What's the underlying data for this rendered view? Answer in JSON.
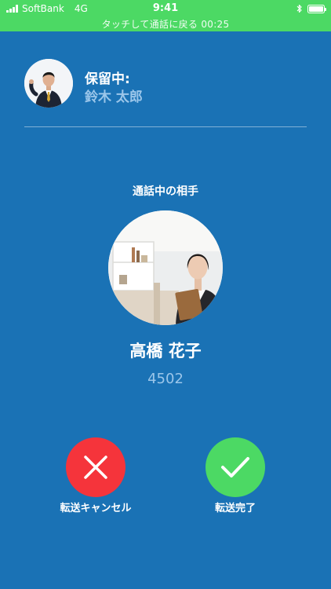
{
  "status_bar": {
    "carrier": "SoftBank",
    "network": "4G",
    "time": "9:41",
    "return_banner": "タッチして通話に戻る 00:25"
  },
  "hold": {
    "status_label": "保留中:",
    "caller_name": "鈴木 太郎"
  },
  "current_call": {
    "section_title": "通話中の相手",
    "name": "高橋 花子",
    "extension": "4502"
  },
  "actions": {
    "cancel_label": "転送キャンセル",
    "complete_label": "転送完了"
  },
  "colors": {
    "background": "#1a72b5",
    "status_bar": "#4cd964",
    "cancel": "#f5343b",
    "complete": "#4cd964",
    "secondary_text": "#9bc6ea"
  },
  "icons": [
    "signal-icon",
    "bluetooth-icon",
    "battery-icon",
    "close-icon",
    "check-icon"
  ]
}
